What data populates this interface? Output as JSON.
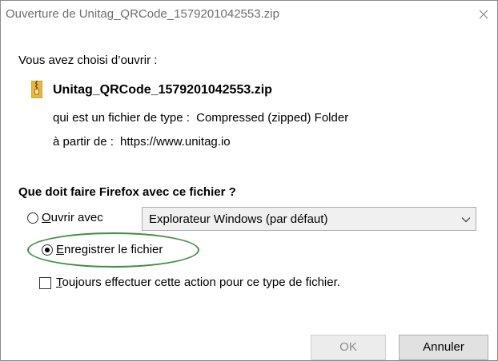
{
  "window": {
    "title": "Ouverture de Unitag_QRCode_1579201042553.zip"
  },
  "intro": "Vous avez choisi d’ouvrir :",
  "file": {
    "name": "Unitag_QRCode_1579201042553.zip",
    "icon": "zip-icon",
    "type_label": "qui est un fichier de type :",
    "type_value": "Compressed (zipped) Folder",
    "from_label": "à partir de :",
    "from_value": "https://www.unitag.io"
  },
  "question": "Que doit faire Firefox avec ce fichier ?",
  "options": {
    "open": {
      "mnemonic": "O",
      "rest": "uvrir avec",
      "selected": false,
      "app_value": "Explorateur Windows (par défaut)"
    },
    "save": {
      "mnemonic": "E",
      "rest": "nregistrer le fichier",
      "selected": true
    },
    "always": {
      "mnemonic": "T",
      "rest": "oujours effectuer cette action pour ce type de fichier.",
      "checked": false
    }
  },
  "buttons": {
    "ok": "OK",
    "cancel": "Annuler"
  },
  "colors": {
    "highlight_ring": "#3e8e3e",
    "title_text": "#6d6d6d",
    "zip_icon": "#e8b73a"
  }
}
